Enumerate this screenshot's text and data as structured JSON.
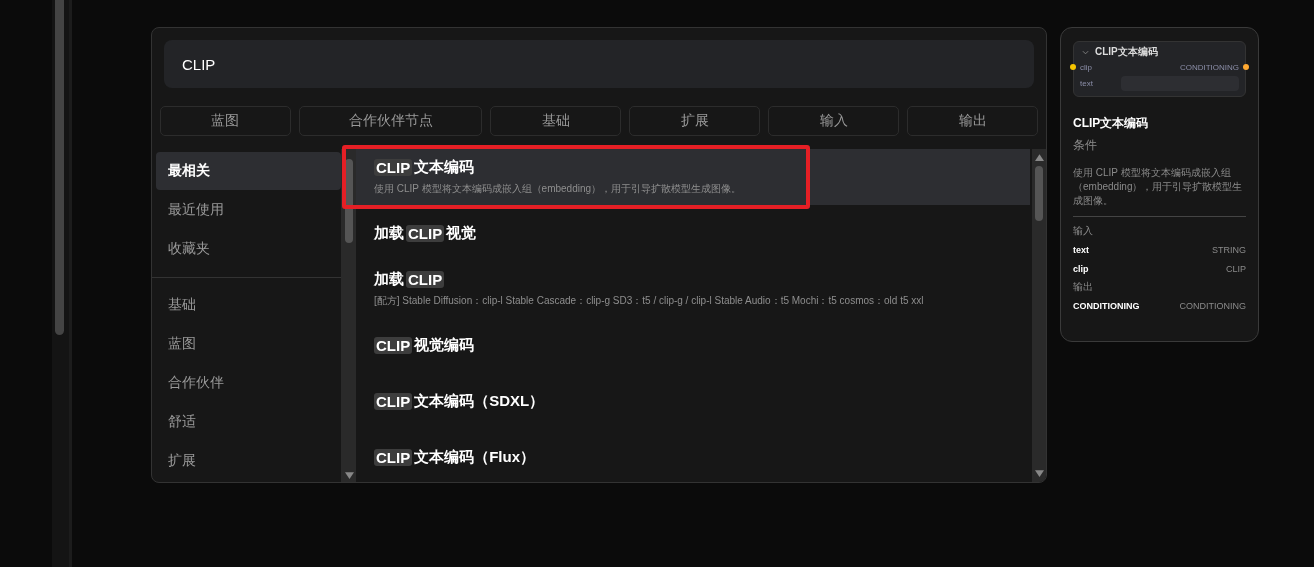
{
  "search": {
    "value": "CLIP"
  },
  "filters": [
    {
      "label": "蓝图",
      "selected": false
    },
    {
      "label": "合作伙伴节点",
      "selected": false
    },
    {
      "label": "基础",
      "selected": false
    },
    {
      "label": "扩展",
      "selected": false
    },
    {
      "label": "输入",
      "selected": false
    },
    {
      "label": "输出",
      "selected": false
    }
  ],
  "sidebar": {
    "sections": [
      {
        "items": [
          {
            "label": "最相关",
            "selected": true
          },
          {
            "label": "最近使用",
            "selected": false
          },
          {
            "label": "收藏夹",
            "selected": false
          }
        ]
      },
      {
        "items": [
          {
            "label": "基础",
            "selected": false
          },
          {
            "label": "蓝图",
            "selected": false
          },
          {
            "label": "合作伙伴",
            "selected": false
          },
          {
            "label": "舒适",
            "selected": false
          },
          {
            "label": "扩展",
            "selected": false
          }
        ]
      }
    ]
  },
  "results": [
    {
      "title": [
        {
          "text": "CLIP",
          "match": true
        },
        {
          "text": "文本编码",
          "match": false
        }
      ],
      "description": "使用 CLIP 模型将文本编码成嵌入组（embedding），用于引导扩散模型生成图像。",
      "selected": true,
      "annotated": true
    },
    {
      "title": [
        {
          "text": "加载",
          "match": false
        },
        {
          "text": "CLIP",
          "match": true
        },
        {
          "text": "视觉",
          "match": false
        }
      ],
      "selected": false,
      "annotated": false
    },
    {
      "title": [
        {
          "text": "加载",
          "match": false
        },
        {
          "text": "CLIP",
          "match": true
        }
      ],
      "description": "[配方] Stable Diffusion：clip-l Stable Cascade：clip-g SD3：t5 / clip-g / clip-l Stable Audio：t5 Mochi：t5 cosmos：old t5 xxl",
      "selected": false,
      "annotated": false
    },
    {
      "title": [
        {
          "text": "CLIP",
          "match": true
        },
        {
          "text": "视觉编码",
          "match": false
        }
      ],
      "selected": false,
      "annotated": false
    },
    {
      "title": [
        {
          "text": "CLIP",
          "match": true
        },
        {
          "text": "文本编码（SDXL）",
          "match": false
        }
      ],
      "selected": false,
      "annotated": false
    },
    {
      "title": [
        {
          "text": "CLIP",
          "match": true
        },
        {
          "text": "文本编码（Flux）",
          "match": false
        }
      ],
      "selected": false,
      "annotated": false
    }
  ],
  "preview": {
    "node": {
      "title": "CLIP文本编码",
      "input": {
        "label": "clip",
        "color": "#f5c400"
      },
      "output": {
        "label": "CONDITIONING",
        "color": "#ffa931"
      },
      "widget": {
        "label": "text"
      }
    },
    "title": "CLIP文本编码",
    "category": "条件",
    "description": "使用 CLIP 模型将文本编码成嵌入组（embedding），用于引导扩散模型生成图像。",
    "inputs_heading": "输入",
    "inputs": [
      {
        "name": "text",
        "type": "STRING"
      },
      {
        "name": "clip",
        "type": "CLIP"
      }
    ],
    "outputs_heading": "输出",
    "outputs": [
      {
        "name": "CONDITIONING",
        "type": "CONDITIONING"
      }
    ]
  }
}
